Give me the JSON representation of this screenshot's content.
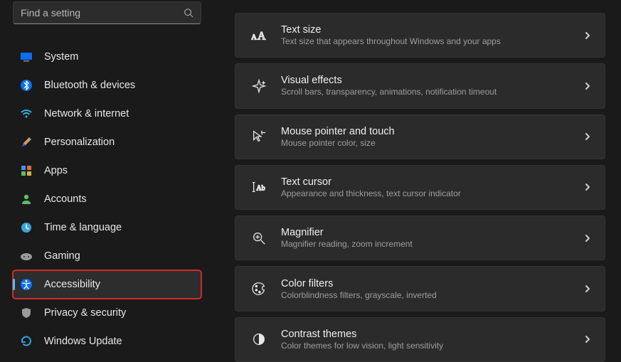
{
  "search": {
    "placeholder": "Find a setting"
  },
  "sidebar": {
    "items": [
      {
        "label": "System"
      },
      {
        "label": "Bluetooth & devices"
      },
      {
        "label": "Network & internet"
      },
      {
        "label": "Personalization"
      },
      {
        "label": "Apps"
      },
      {
        "label": "Accounts"
      },
      {
        "label": "Time & language"
      },
      {
        "label": "Gaming"
      },
      {
        "label": "Accessibility"
      },
      {
        "label": "Privacy & security"
      },
      {
        "label": "Windows Update"
      }
    ]
  },
  "main": {
    "cards": [
      {
        "title": "Text size",
        "desc": "Text size that appears throughout Windows and your apps"
      },
      {
        "title": "Visual effects",
        "desc": "Scroll bars, transparency, animations, notification timeout"
      },
      {
        "title": "Mouse pointer and touch",
        "desc": "Mouse pointer color, size"
      },
      {
        "title": "Text cursor",
        "desc": "Appearance and thickness, text cursor indicator"
      },
      {
        "title": "Magnifier",
        "desc": "Magnifier reading, zoom increment"
      },
      {
        "title": "Color filters",
        "desc": "Colorblindness filters, grayscale, inverted"
      },
      {
        "title": "Contrast themes",
        "desc": "Color themes for low vision, light sensitivity"
      }
    ]
  }
}
